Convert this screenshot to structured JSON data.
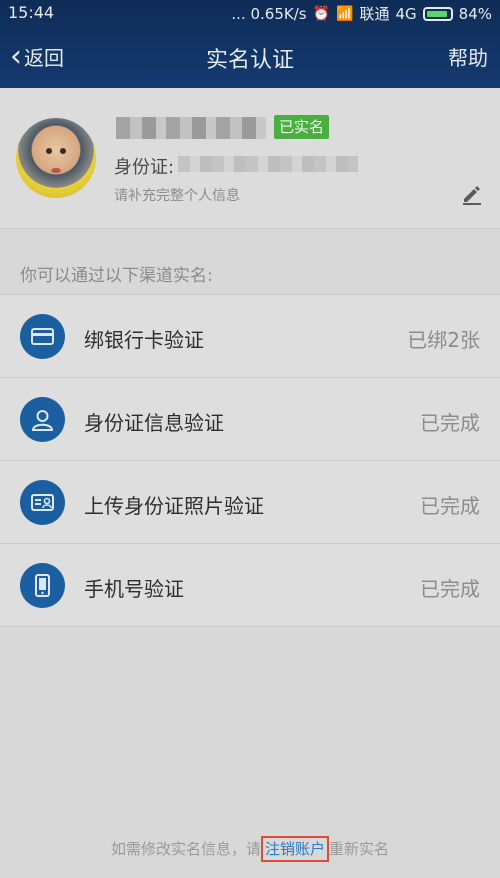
{
  "status_bar": {
    "time": "15:44",
    "network_speed": "... 0.65K/s",
    "carrier": "联通",
    "network_type": "4G",
    "battery": "84%"
  },
  "nav": {
    "back_label": "返回",
    "title": "实名认证",
    "help_label": "帮助"
  },
  "profile": {
    "verified_badge": "已实名",
    "id_label": "身份证:",
    "tip": "请补充完整个人信息"
  },
  "section_label": "你可以通过以下渠道实名:",
  "methods": [
    {
      "icon": "bank-card-icon",
      "title": "绑银行卡验证",
      "status": "已绑2张"
    },
    {
      "icon": "person-icon",
      "title": "身份证信息验证",
      "status": "已完成"
    },
    {
      "icon": "id-card-icon",
      "title": "上传身份证照片验证",
      "status": "已完成"
    },
    {
      "icon": "phone-icon",
      "title": "手机号验证",
      "status": "已完成"
    }
  ],
  "footer": {
    "prefix": "如需修改实名信息，请",
    "link": "注销账户",
    "suffix": "重新实名"
  },
  "colors": {
    "nav_bar": "#153a70",
    "badge": "#49b03f",
    "icon_circle": "#1b5fa0",
    "link": "#2a79c4",
    "highlight_box": "#e04a3b"
  }
}
